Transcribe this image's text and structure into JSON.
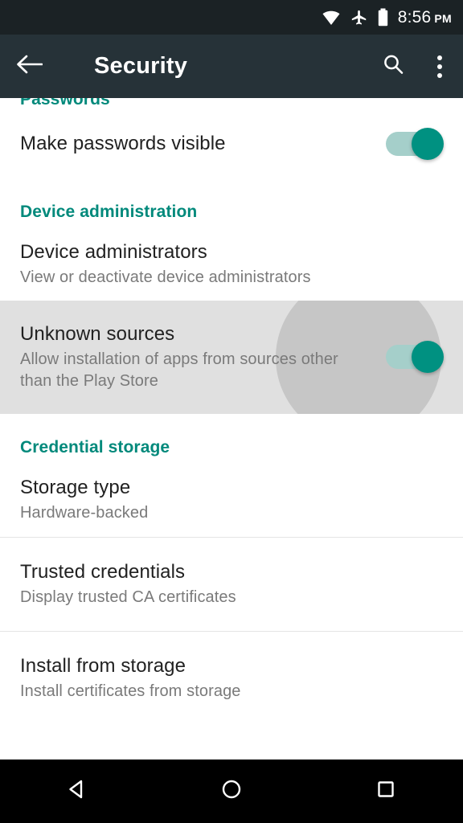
{
  "status_bar": {
    "icons": [
      "wifi-icon",
      "airplane-mode-icon",
      "battery-icon"
    ],
    "time": "8:56",
    "ampm": "PM"
  },
  "app_bar": {
    "back_icon": "back-arrow-icon",
    "title": "Security",
    "search_icon": "search-icon",
    "overflow_icon": "overflow-menu-icon"
  },
  "colors": {
    "accent_teal": "#00897b",
    "toggle_on": "#009181",
    "toggle_track": "#a5cfca",
    "app_bar": "#263238",
    "status_bar": "#1b2225",
    "pressed_row": "#e0e0e0",
    "ripple": "#c6c6c6"
  },
  "sections": [
    {
      "header": "Passwords",
      "rows": [
        {
          "title": "Make passwords visible",
          "summary": "",
          "toggle": "on"
        }
      ]
    },
    {
      "header": "Device administration",
      "rows": [
        {
          "title": "Device administrators",
          "summary": "View or deactivate device administrators",
          "toggle": null
        },
        {
          "title": "Unknown sources",
          "summary": "Allow installation of apps from sources other than the Play Store",
          "toggle": "on",
          "state": "pressed"
        }
      ]
    },
    {
      "header": "Credential storage",
      "rows": [
        {
          "title": "Storage type",
          "summary": "Hardware-backed",
          "toggle": null
        },
        {
          "title": "Trusted credentials",
          "summary": "Display trusted CA certificates",
          "toggle": null
        },
        {
          "title": "Install from storage",
          "summary": "Install certificates from storage",
          "toggle": null
        }
      ]
    }
  ],
  "nav_bar": {
    "back": "nav-back-icon",
    "home": "nav-home-icon",
    "recents": "nav-recents-icon"
  }
}
